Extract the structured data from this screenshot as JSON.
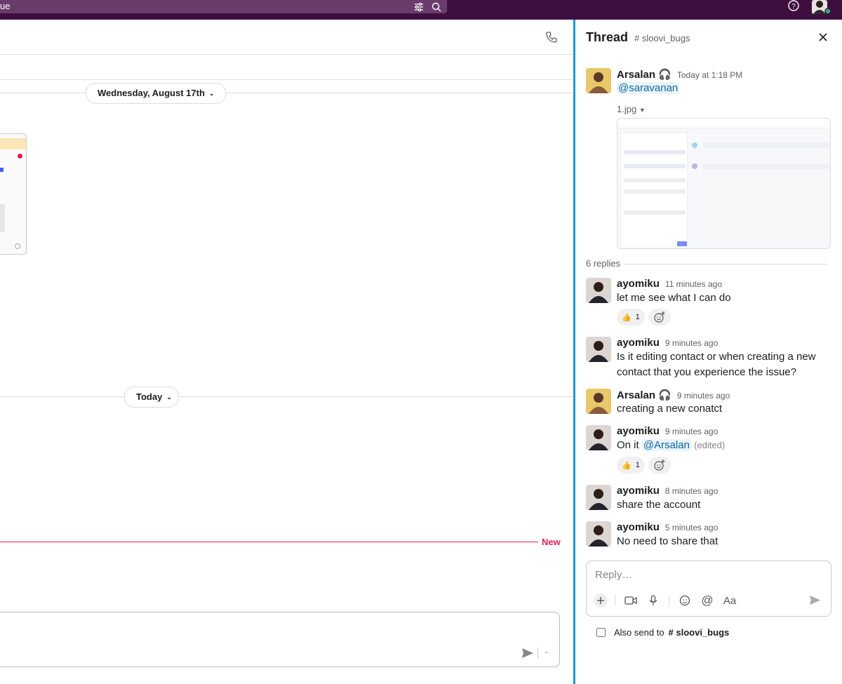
{
  "topbar": {
    "search_value": "ue"
  },
  "main": {
    "date_divider": "Wednesday, August 17th",
    "today_divider": "Today",
    "new_label": "New"
  },
  "thread": {
    "title": "Thread",
    "channel": "# sloovi_bugs",
    "root": {
      "author": "Arsalan 🎧",
      "time": "Today at 1:18 PM",
      "mention": "@saravanan",
      "file_name": "1.jpg"
    },
    "replies_count": "6 replies",
    "messages": [
      {
        "author": "ayomiku",
        "time": "11 minutes ago",
        "text": "let me see what I can do",
        "reaction": "👍",
        "reaction_count": "1"
      },
      {
        "author": "ayomiku",
        "time": "9 minutes ago",
        "text_line1": "Is it editing contact or when creating a new",
        "text_line2": "contact that  you experience the issue?"
      },
      {
        "author": "Arsalan 🎧",
        "time": "9 minutes ago",
        "text": "creating a new conatct"
      },
      {
        "author": "ayomiku",
        "time": "9 minutes ago",
        "text": "On it",
        "mention": "@Arsalan",
        "edited": "(edited)",
        "reaction": "👍",
        "reaction_count": "1"
      },
      {
        "author": "ayomiku",
        "time": "8 minutes ago",
        "text": "share the account"
      },
      {
        "author": "ayomiku",
        "time": "5 minutes ago",
        "text": "No need to share that"
      }
    ],
    "reply_placeholder": "Reply…",
    "also_send_label": "Also send to",
    "also_send_channel": "# sloovi_bugs"
  },
  "colors": {
    "topbar": "#3f0e40",
    "accent": "#1d9bd1",
    "new_marker": "#e01e5a",
    "mention": "#1264a3"
  }
}
